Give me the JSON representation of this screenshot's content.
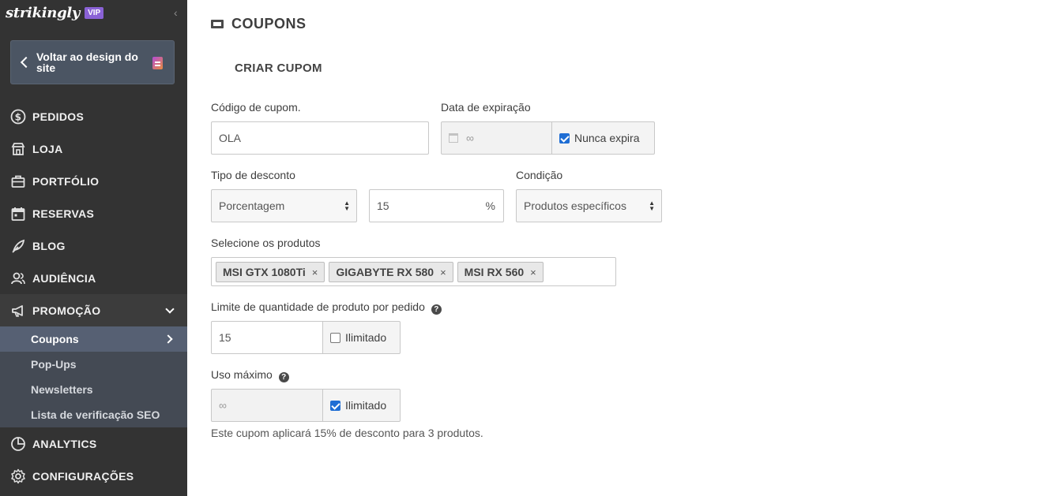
{
  "sidebar": {
    "brand": "strikingly",
    "badge": "VIP",
    "back_label": "Voltar ao design do site",
    "nav": [
      {
        "label": "PEDIDOS",
        "icon": "dollar-circle-icon"
      },
      {
        "label": "LOJA",
        "icon": "store-icon"
      },
      {
        "label": "PORTFÓLIO",
        "icon": "briefcase-icon"
      },
      {
        "label": "RESERVAS",
        "icon": "calendar-icon"
      },
      {
        "label": "BLOG",
        "icon": "feather-icon"
      },
      {
        "label": "AUDIÊNCIA",
        "icon": "users-icon"
      },
      {
        "label": "PROMOÇÃO",
        "icon": "megaphone-icon"
      }
    ],
    "promo_sub": [
      "Coupons",
      "Pop-Ups",
      "Newsletters",
      "Lista de verificação SEO"
    ],
    "bottom_nav": [
      {
        "label": "ANALYTICS",
        "icon": "pie-chart-icon"
      },
      {
        "label": "CONFIGURAÇÕES",
        "icon": "gear-icon"
      }
    ]
  },
  "main": {
    "title": "COUPONS",
    "section_title": "CRIAR CUPOM",
    "code_label": "Código de cupom.",
    "code_value": "OLA",
    "expiry_label": "Data de expiração",
    "expiry_value": "∞",
    "never_expires_label": "Nunca expira",
    "discount_type_label": "Tipo de desconto",
    "discount_type_value": "Porcentagem",
    "discount_amount": "15",
    "discount_unit": "%",
    "condition_label": "Condição",
    "condition_value": "Produtos específicos",
    "products_label": "Selecione os produtos",
    "products": [
      "MSI GTX 1080Ti",
      "GIGABYTE RX 580",
      "MSI RX 560"
    ],
    "qty_limit_label": "Limite de quantidade de produto por pedido",
    "qty_limit_value": "15",
    "unlimited_label": "Ilimitado",
    "max_use_label": "Uso máximo",
    "max_use_value": "∞",
    "summary": "Este cupom aplicará 15% de desconto para 3 produtos."
  },
  "colors": {
    "sidebar_bg": "#333333",
    "accent": "#8a62d6",
    "checkbox": "#1f6ed4"
  }
}
